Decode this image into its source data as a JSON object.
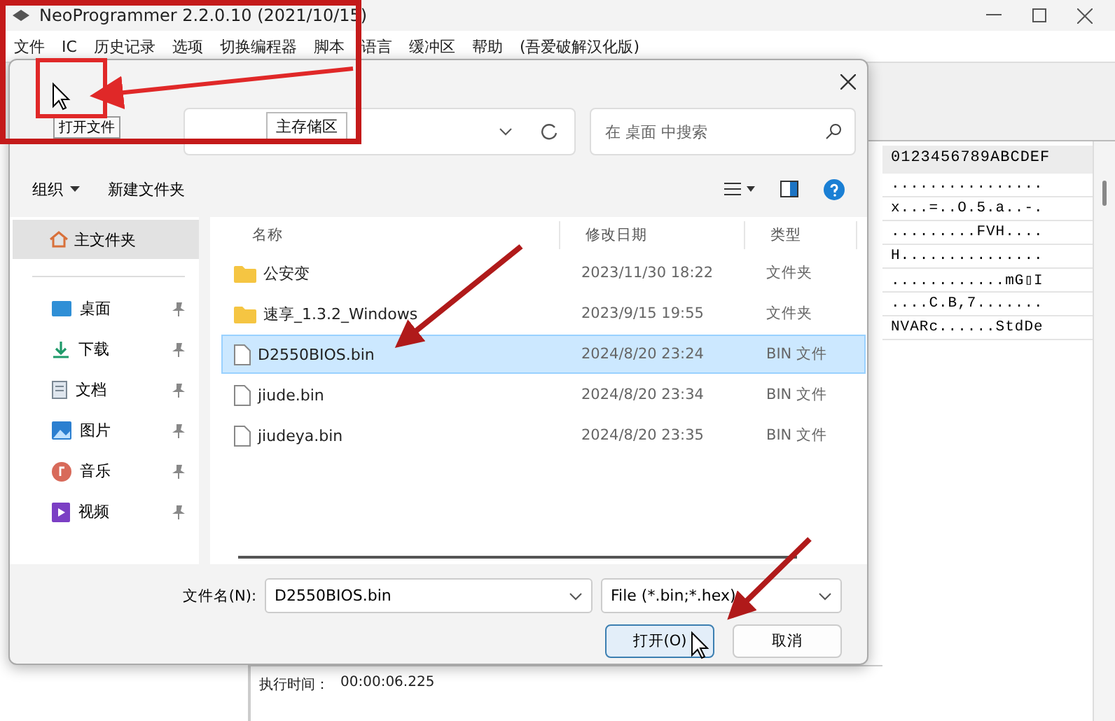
{
  "app": {
    "title": "NeoProgrammer 2.2.0.10 (2021/10/15)",
    "menu": [
      "文件",
      "IC",
      "历史记录",
      "选项",
      "切换编程器",
      "脚本",
      "语言",
      "缓冲区",
      "帮助",
      "(吾爱破解汉化版)"
    ],
    "tooltip": "打开文件",
    "tabs": [
      {
        "label": "主存储区",
        "selected": true
      }
    ],
    "hex_header": "0123456789ABCDEF",
    "hex_rows": [
      "................",
      "x...=..O.5.a..-.",
      ".........FVH....",
      "H...............",
      "............mG▯I",
      "....C.B,7.......",
      "NVARc......StdDe"
    ],
    "log": {
      "label": "执行时间：",
      "value": "00:00:06.225"
    }
  },
  "dialog": {
    "search": {
      "placeholder": "在 桌面 中搜索"
    },
    "commands": [
      {
        "label": "组织",
        "kind": "menu"
      },
      {
        "label": "新建文件夹",
        "kind": "plain"
      }
    ],
    "home": {
      "label": "主文件夹",
      "selected": true
    },
    "places": [
      {
        "label": "桌面",
        "kind": "desktop"
      },
      {
        "label": "下载",
        "kind": "download"
      },
      {
        "label": "文档",
        "kind": "document"
      },
      {
        "label": "图片",
        "kind": "picture"
      },
      {
        "label": "音乐",
        "kind": "music"
      },
      {
        "label": "视频",
        "kind": "video"
      }
    ],
    "columns": [
      "名称",
      "修改日期",
      "类型"
    ],
    "files": [
      {
        "name": "公安变",
        "date": "2023/11/30 18:22",
        "type": "文件夹",
        "kind": "folder",
        "selected": false
      },
      {
        "name": "速享_1.3.2_Windows",
        "date": "2023/9/15 19:55",
        "type": "文件夹",
        "kind": "folder",
        "selected": false
      },
      {
        "name": "D2550BIOS.bin",
        "date": "2024/8/20 23:24",
        "type": "BIN 文件",
        "kind": "file",
        "selected": true
      },
      {
        "name": "jiude.bin",
        "date": "2024/8/20 23:34",
        "type": "BIN 文件",
        "kind": "file",
        "selected": false
      },
      {
        "name": "jiudeya.bin",
        "date": "2024/8/20 23:35",
        "type": "BIN 文件",
        "kind": "file",
        "selected": false
      }
    ],
    "filename": {
      "label": "文件名(N):",
      "value": "D2550BIOS.bin"
    },
    "filter": "File  (*.bin;*.hex)",
    "buttons": [
      {
        "label": "打开(O)",
        "kind": "primary"
      },
      {
        "label": "取消",
        "kind": "secondary"
      }
    ]
  }
}
